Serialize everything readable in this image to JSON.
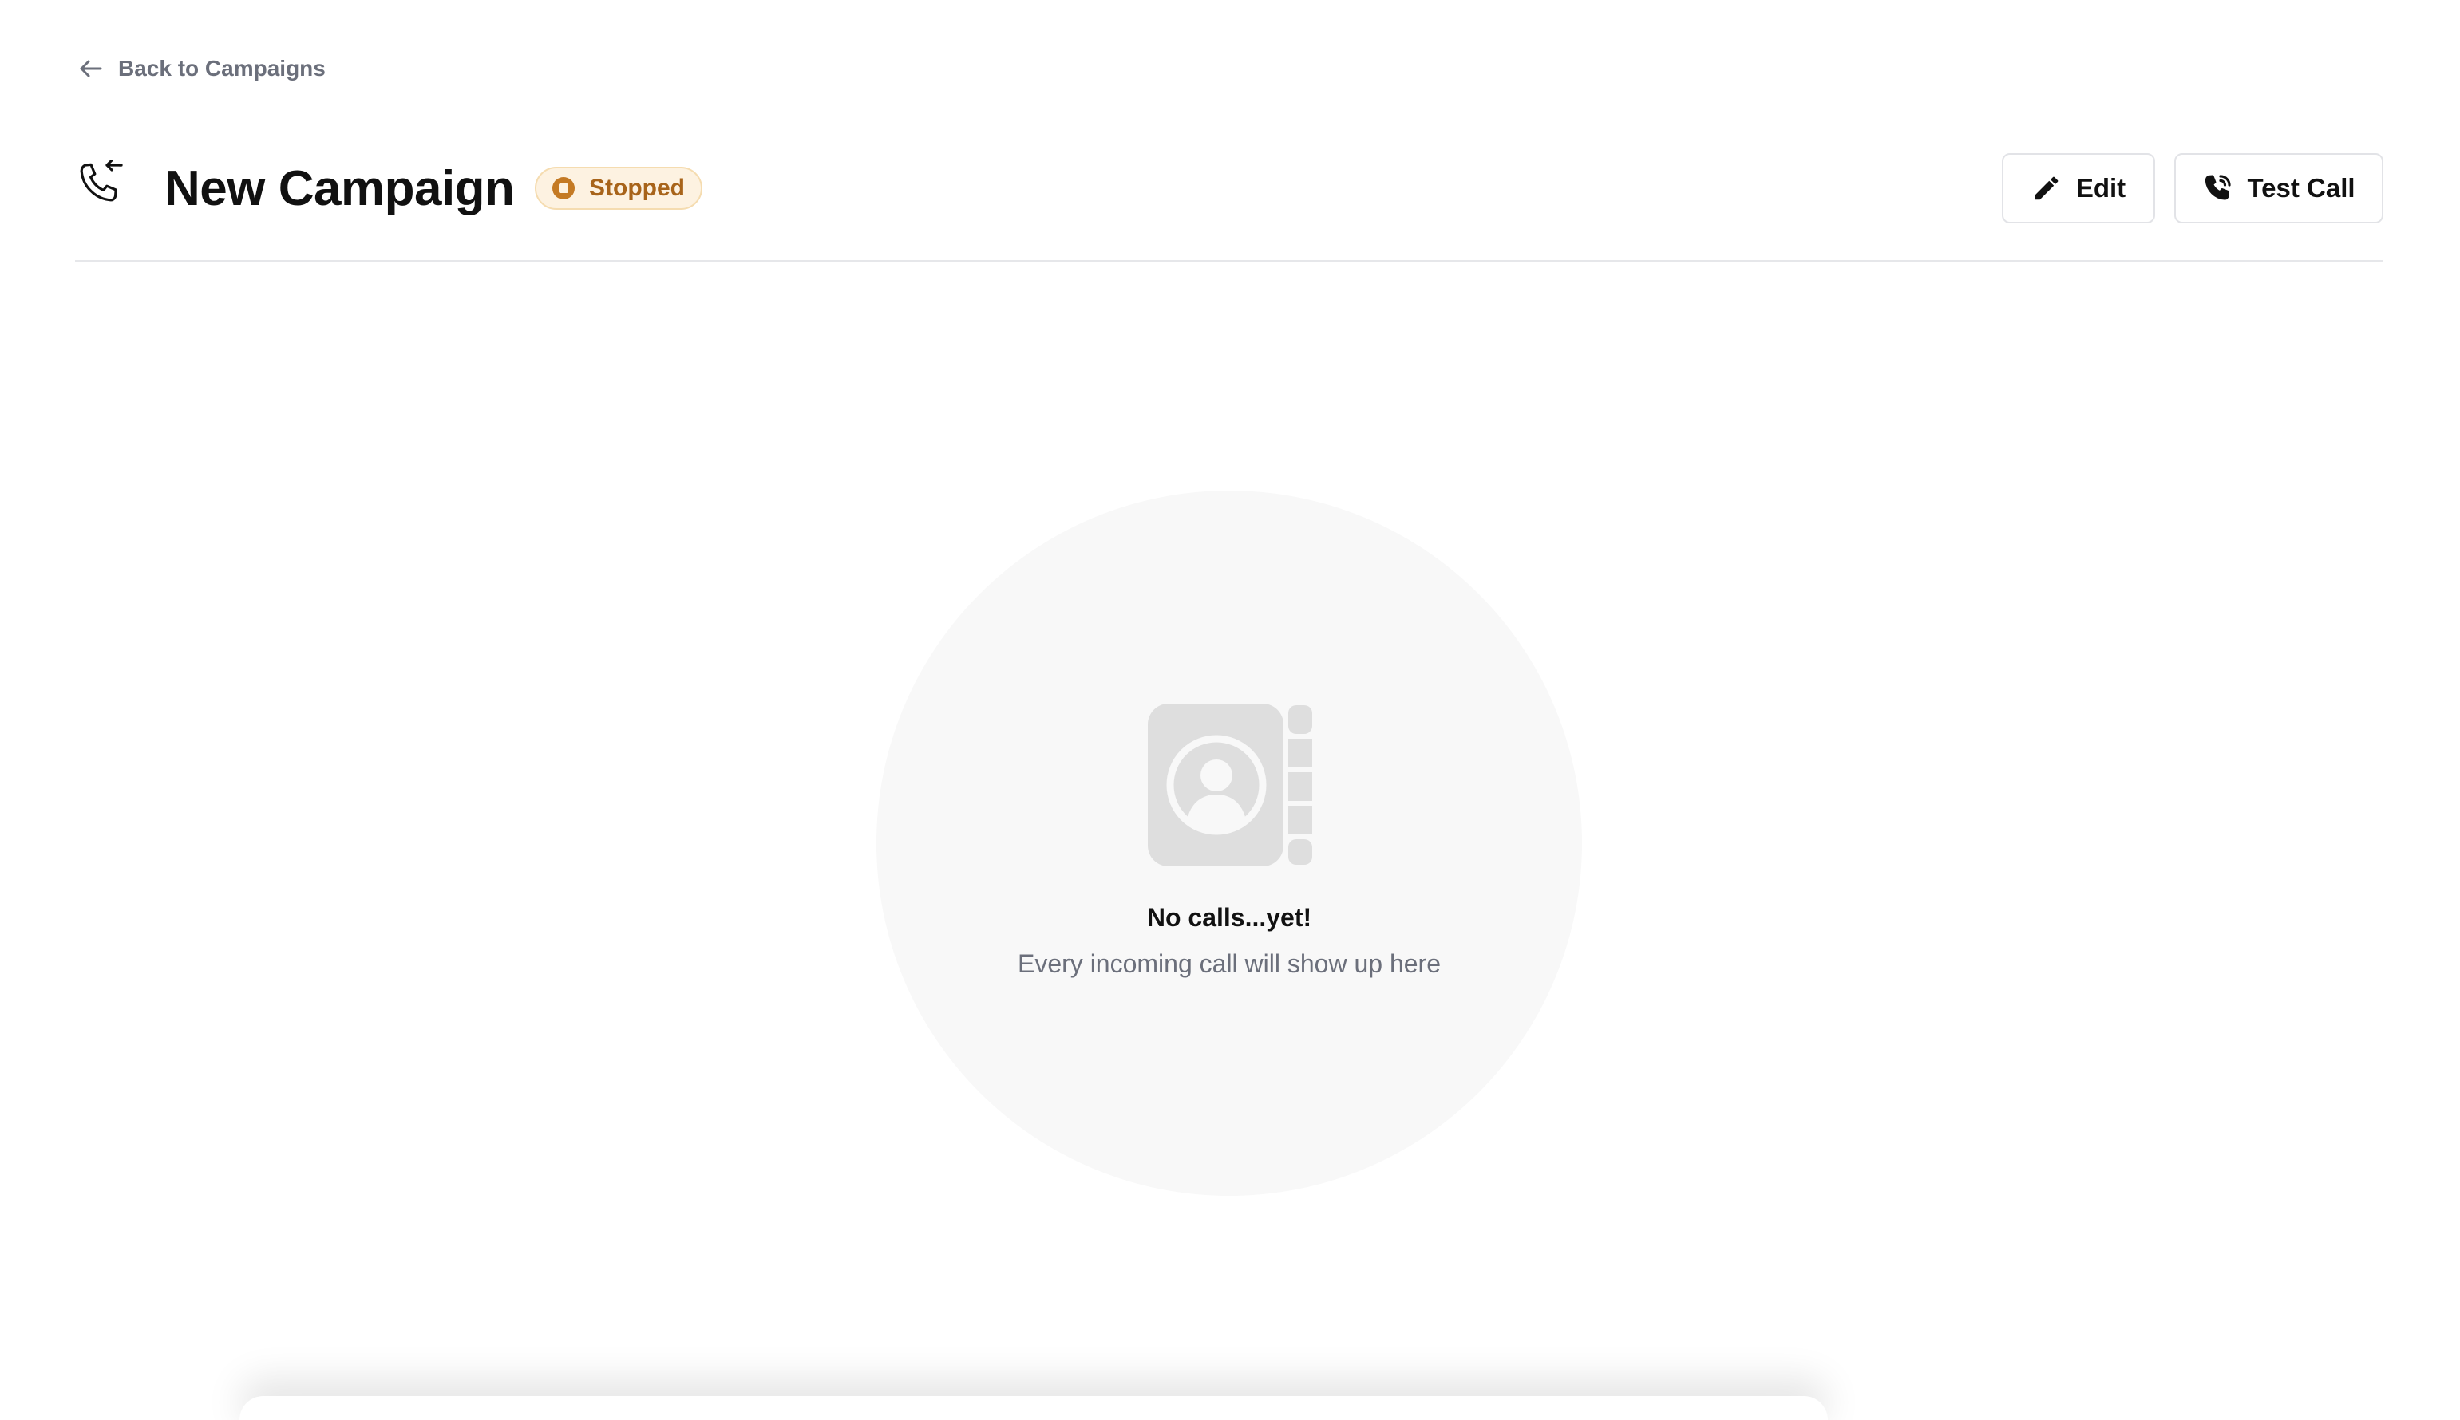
{
  "nav": {
    "back_label": "Back to Campaigns",
    "back_icon": "arrow-left-icon"
  },
  "header": {
    "icon": "phone-incoming-icon",
    "title": "New Campaign",
    "status": {
      "label": "Stopped",
      "icon": "stop-circle-icon",
      "color": "#a8641a",
      "background": "#fdf2e1"
    },
    "actions": {
      "edit_label": "Edit",
      "edit_icon": "pencil-icon",
      "test_call_label": "Test Call",
      "test_call_icon": "phone-calling-icon"
    }
  },
  "empty_state": {
    "icon": "contact-book-icon",
    "title": "No calls...yet!",
    "subtitle": "Every incoming call will show up here"
  }
}
